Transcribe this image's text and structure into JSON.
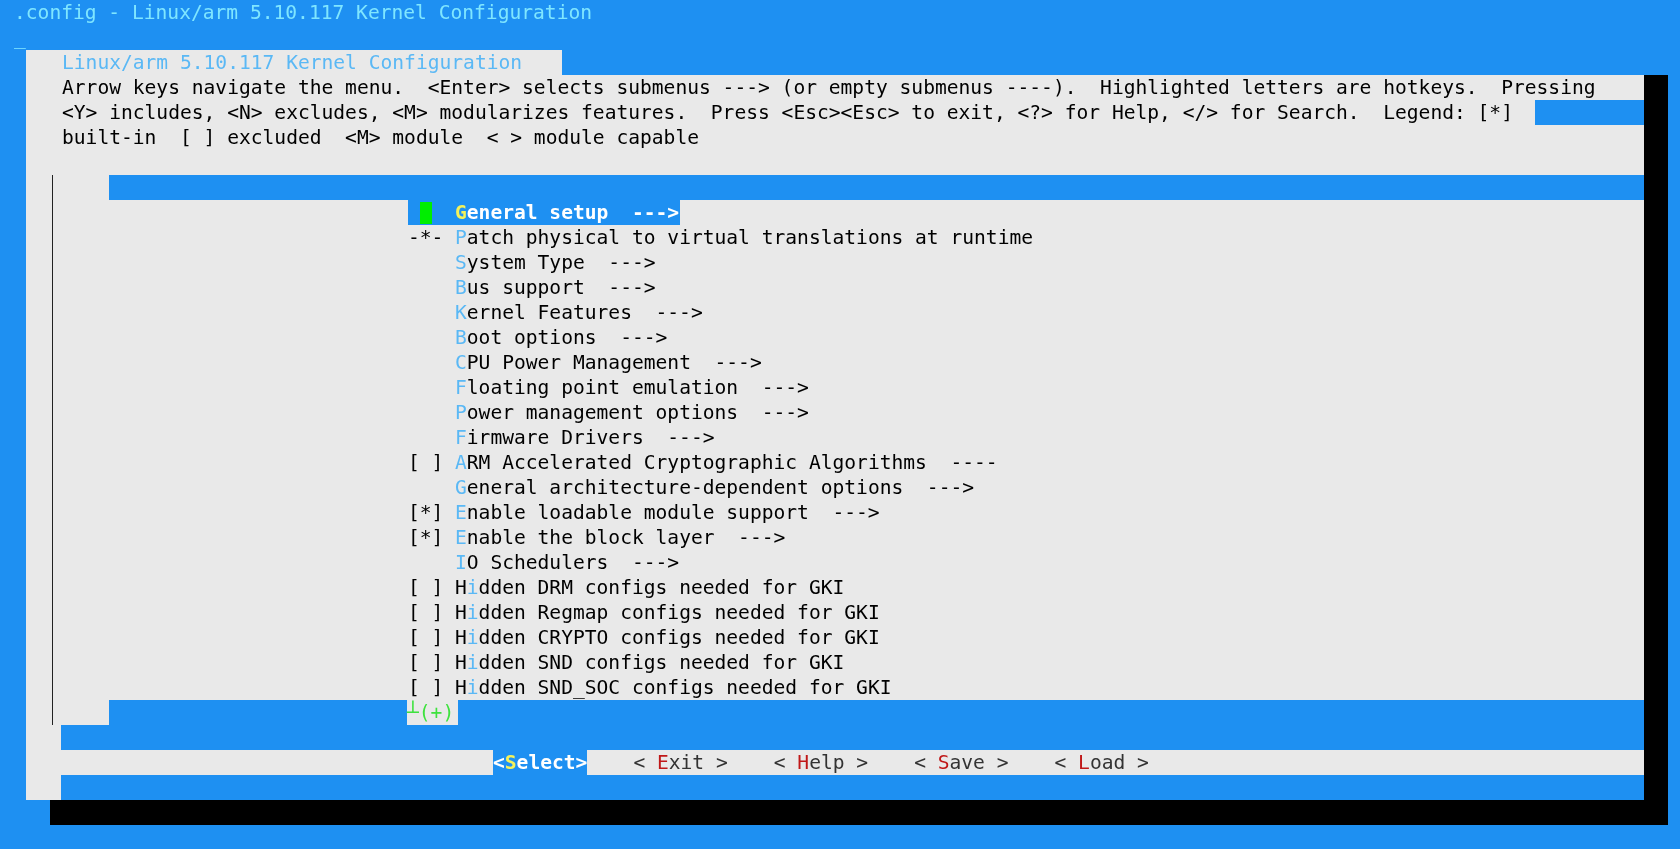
{
  "window": {
    "title": ".config - Linux/arm 5.10.117 Kernel Configuration",
    "cursor": "_"
  },
  "dialog": {
    "title": "Linux/arm 5.10.117 Kernel Configuration",
    "help_lines": [
      "Arrow keys navigate the menu.  <Enter> selects submenus ---> (or empty submenus ----).  Highlighted letters are hotkeys.  Pressing",
      "<Y> includes, <N> excludes, <M> modularizes features.  Press <Esc><Esc> to exit, <?> for Help, </> for Search.  Legend: [*]",
      "built-in  [ ] excluded  <M> module  < > module capable"
    ]
  },
  "menu": {
    "items": [
      {
        "marker": "",
        "hotkey": "G",
        "text": "eneral setup",
        "arrow": "--->",
        "selected": true
      },
      {
        "marker": "-*-",
        "hotkey": "P",
        "text": "atch physical to virtual translations at runtime",
        "selected": false
      },
      {
        "marker": "",
        "hotkey": "S",
        "text": "ystem Type",
        "arrow": "--->",
        "selected": false
      },
      {
        "marker": "",
        "hotkey": "B",
        "text": "us support",
        "arrow": "--->",
        "selected": false
      },
      {
        "marker": "",
        "hotkey": "K",
        "text": "ernel Features",
        "arrow": "--->",
        "selected": false
      },
      {
        "marker": "",
        "hotkey": "B",
        "text": "oot options",
        "arrow": "--->",
        "selected": false
      },
      {
        "marker": "",
        "hotkey": "C",
        "text": "PU Power Management",
        "arrow": "--->",
        "selected": false
      },
      {
        "marker": "",
        "hotkey": "F",
        "text": "loating point emulation",
        "arrow": "--->",
        "selected": false
      },
      {
        "marker": "",
        "hotkey": "P",
        "text": "ower management options",
        "arrow": "--->",
        "selected": false
      },
      {
        "marker": "",
        "hotkey": "F",
        "text": "irmware Drivers",
        "arrow": "--->",
        "selected": false
      },
      {
        "marker": "[ ]",
        "hotkey": "A",
        "text": "RM Accelerated Cryptographic Algorithms",
        "arrow": "----",
        "selected": false
      },
      {
        "marker": "",
        "hotkey": "G",
        "text": "eneral architecture-dependent options",
        "arrow": "--->",
        "selected": false
      },
      {
        "marker": "[*]",
        "hotkey": "E",
        "text": "nable loadable module support",
        "arrow": "--->",
        "selected": false
      },
      {
        "marker": "[*]",
        "hotkey": "E",
        "text": "nable the block layer",
        "arrow": "--->",
        "selected": false
      },
      {
        "marker": "",
        "hotkey": "I",
        "text": "O Schedulers",
        "arrow": "--->",
        "selected": false
      },
      {
        "marker": "[ ]",
        "pre": "H",
        "hotkey": "i",
        "text": "dden DRM configs needed for GKI",
        "selected": false
      },
      {
        "marker": "[ ]",
        "pre": "H",
        "hotkey": "i",
        "text": "dden Regmap configs needed for GKI",
        "selected": false
      },
      {
        "marker": "[ ]",
        "pre": "H",
        "hotkey": "i",
        "text": "dden CRYPTO configs needed for GKI",
        "selected": false
      },
      {
        "marker": "[ ]",
        "pre": "H",
        "hotkey": "i",
        "text": "dden SND configs needed for GKI",
        "selected": false
      },
      {
        "marker": "[ ]",
        "pre": "H",
        "hotkey": "i",
        "text": "dden SND_SOC configs needed for GKI",
        "selected": false
      }
    ],
    "more_indicator": "┴(+)"
  },
  "buttons": [
    {
      "pre": "<",
      "hotkey": "S",
      "post": "elect>",
      "selected": true
    },
    {
      "pre": "< ",
      "hotkey": "E",
      "post": "xit >",
      "selected": false
    },
    {
      "pre": "< ",
      "hotkey": "H",
      "post": "elp >",
      "selected": false
    },
    {
      "pre": "< ",
      "hotkey": "S",
      "post": "ave >",
      "selected": false
    },
    {
      "pre": "< ",
      "hotkey": "L",
      "post": "oad >",
      "selected": false
    }
  ]
}
